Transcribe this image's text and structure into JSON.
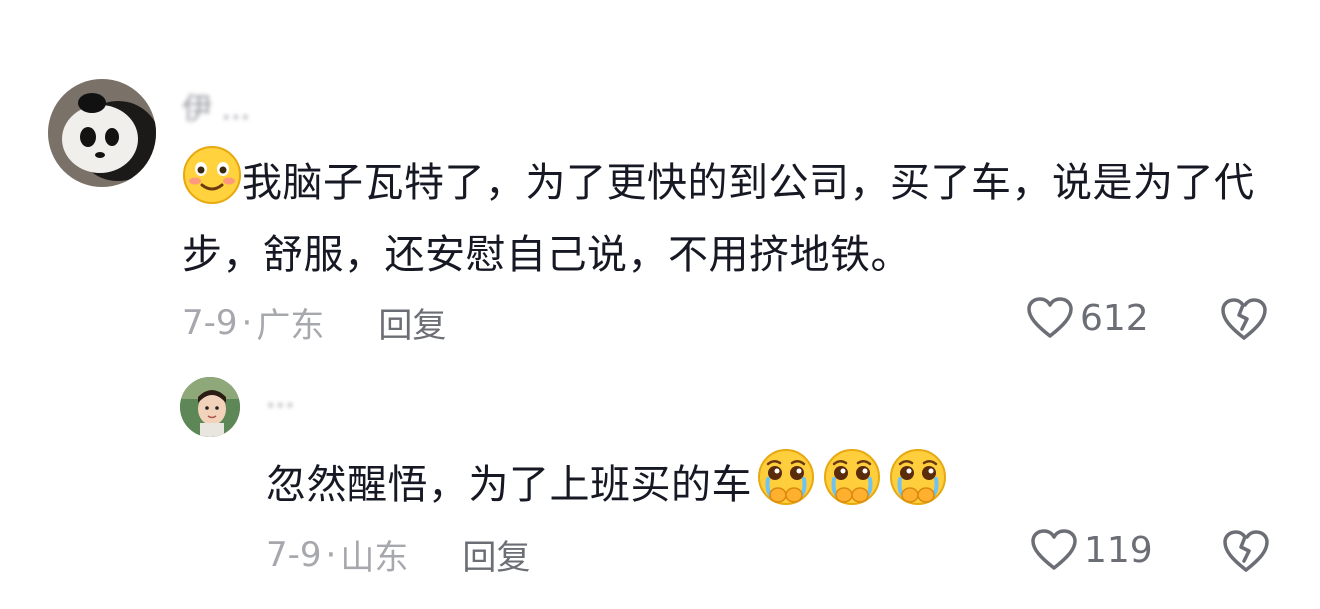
{
  "comments": [
    {
      "username": "伊 ...",
      "text_main": "我脑子瓦特了，为了更快的到公司，买了车，说是为了代步，舒服，还安慰自己说，不用挤地铁。",
      "leading_emoji": "smile-blush-emoji",
      "date": "7-9",
      "location": "广东",
      "reply_label": "回复",
      "like_count": "612"
    },
    {
      "username": "...",
      "text_main": "忽然醒悟，为了上班买的车",
      "trailing_emojis": [
        "pleading-tearful-emoji",
        "pleading-tearful-emoji",
        "pleading-tearful-emoji"
      ],
      "date": "7-9",
      "location": "山东",
      "reply_label": "回复",
      "like_count": "119"
    }
  ],
  "meta_separator": "·",
  "colors": {
    "text": "#161823",
    "meta": "#a7a8ad",
    "action": "#6c6e75"
  }
}
